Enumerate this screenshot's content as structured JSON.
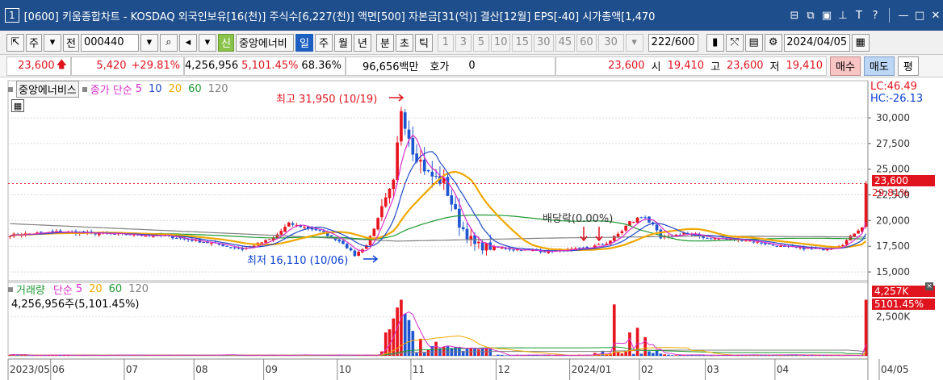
{
  "title": {
    "num": "1",
    "text": "[0600] 키움종합차트 - KOSDAQ 외국인보유[16(천)] 주식수[6,227(천)] 액면[500] 자본금[31(억)] 결산[12월] EPS[-40] 시가총액[1,470"
  },
  "toolbar": {
    "mode": "주",
    "prev": "전",
    "code": "000440",
    "new_label": "신",
    "name": "중앙에너비",
    "periods": [
      "일",
      "주",
      "월",
      "년",
      "분",
      "초",
      "틱"
    ],
    "minutes": [
      "1",
      "3",
      "5",
      "10",
      "15",
      "30",
      "45",
      "60"
    ],
    "sel_min": "30",
    "count": "222",
    "count_max": "/600",
    "date": "2024/04/05"
  },
  "quote": {
    "price": "23,600",
    "change": "5,420",
    "change_pct": "+29.81%",
    "volume": "4,256,956",
    "vol_ratio": "5,101.45%",
    "turnover": "68.36%",
    "amount": "96,656백만",
    "hoga_label": "호가",
    "hoga_value": "0",
    "hoga_price": "23,600",
    "open_label": "시",
    "open": "19,410",
    "high_label": "고",
    "high": "23,600",
    "low_label": "저",
    "low": "19,410",
    "buy": "매수",
    "sell": "매도",
    "avg": "평"
  },
  "price_panel": {
    "name": "중앙에너비스",
    "legend_prefix": "종가 단순",
    "ma_periods": [
      "5",
      "10",
      "20",
      "60",
      "120"
    ],
    "lc": "LC:46.49",
    "hc": "HC:-26.13",
    "cur_price": "23,600",
    "cur_pct": "29.81%",
    "high_note": "최고 31,950 (10/19)",
    "low_note": "최저 16,110 (10/06)",
    "dividend_note": "배당락(0.00%)"
  },
  "volume_panel": {
    "name": "거래량",
    "legend_prefix": "단순",
    "ma_periods": [
      "5",
      "20",
      "60",
      "120"
    ],
    "sub": "4,256,956주(5,101.45%)",
    "cur": "4,257K",
    "cur_pct": "5101.45%",
    "tick": "2,500K"
  },
  "colors": {
    "up": "#e8141e",
    "down": "#1e56d2",
    "ma5": "#d62fc9",
    "ma10": "#2048c8",
    "ma20": "#f0a800",
    "ma60": "#1f9a33",
    "ma120": "#808080"
  },
  "chart_data": {
    "type": "candlestick",
    "y_ticks": [
      15000,
      17500,
      20000,
      22500,
      25000,
      27500,
      30000
    ],
    "ylim": [
      14300,
      33300
    ],
    "x_labels": [
      "2023/05",
      "06",
      "07",
      "08",
      "09",
      "10",
      "11",
      "12",
      "2024/01",
      "02",
      "03",
      "04",
      "04/05"
    ],
    "annotations": [
      {
        "text": "최고 31,950 (10/19)",
        "value": 31950
      },
      {
        "text": "최저 16,110 (10/06)",
        "value": 16110
      },
      {
        "text": "배당락(0.00%)"
      }
    ],
    "price_anchors": [
      [
        0,
        18600
      ],
      [
        12,
        18900
      ],
      [
        25,
        18700
      ],
      [
        40,
        18500
      ],
      [
        55,
        17600
      ],
      [
        60,
        17200
      ],
      [
        68,
        18300
      ],
      [
        72,
        19700
      ],
      [
        80,
        19000
      ],
      [
        86,
        17800
      ],
      [
        89,
        16600
      ],
      [
        92,
        17600
      ],
      [
        96,
        21000
      ],
      [
        99,
        23500
      ],
      [
        101,
        31000
      ],
      [
        104,
        27000
      ],
      [
        108,
        24500
      ],
      [
        112,
        23700
      ],
      [
        116,
        19700
      ],
      [
        120,
        17600
      ],
      [
        130,
        17200
      ],
      [
        138,
        17000
      ],
      [
        146,
        17200
      ],
      [
        152,
        17500
      ],
      [
        156,
        18300
      ],
      [
        160,
        19800
      ],
      [
        164,
        20500
      ],
      [
        168,
        18200
      ],
      [
        174,
        18800
      ],
      [
        180,
        18300
      ],
      [
        190,
        18100
      ],
      [
        200,
        17400
      ],
      [
        210,
        17200
      ],
      [
        215,
        17700
      ],
      [
        218,
        18800
      ],
      [
        220,
        19410
      ],
      [
        221,
        23600
      ]
    ],
    "ma_slow_anchors": [
      [
        0,
        19700
      ],
      [
        60,
        18700
      ],
      [
        100,
        18000
      ],
      [
        140,
        18300
      ],
      [
        180,
        18500
      ],
      [
        221,
        18400
      ]
    ],
    "volume_k": {
      "spikes": [
        [
          97,
          1500
        ],
        [
          98,
          1700
        ],
        [
          99,
          2400
        ],
        [
          100,
          3100
        ],
        [
          101,
          3600
        ],
        [
          102,
          2700
        ],
        [
          103,
          2300
        ],
        [
          104,
          1600
        ],
        [
          106,
          1100
        ],
        [
          110,
          900
        ],
        [
          114,
          500
        ],
        [
          156,
          3300
        ],
        [
          160,
          1500
        ],
        [
          162,
          1800
        ],
        [
          164,
          1200
        ],
        [
          221,
          3600
        ]
      ],
      "ylim": [
        0,
        4300
      ]
    }
  }
}
